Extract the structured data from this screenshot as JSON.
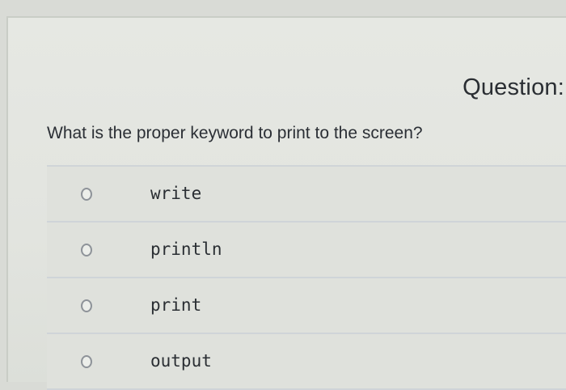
{
  "quiz": {
    "header": "Question:",
    "question": "What is the proper keyword to print to the screen?",
    "options": [
      {
        "label": "write"
      },
      {
        "label": "println"
      },
      {
        "label": "print"
      },
      {
        "label": "output"
      }
    ]
  }
}
